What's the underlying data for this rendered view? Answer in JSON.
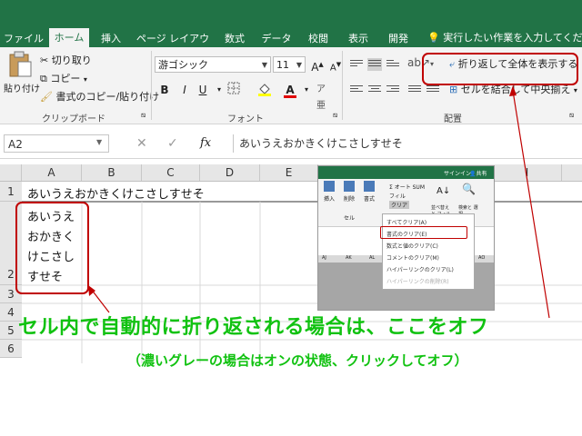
{
  "tabs": [
    {
      "label": "ファイル",
      "active": false
    },
    {
      "label": "ホーム",
      "active": true
    },
    {
      "label": "挿入",
      "active": false
    },
    {
      "label": "ページ レイアウト",
      "active": false
    },
    {
      "label": "数式",
      "active": false
    },
    {
      "label": "データ",
      "active": false
    },
    {
      "label": "校閲",
      "active": false
    },
    {
      "label": "表示",
      "active": false
    },
    {
      "label": "開発",
      "active": false
    }
  ],
  "tell_me": "実行したい作業を入力してください",
  "clipboard": {
    "paste": "貼り付け",
    "cut": "切り取り",
    "copy": "コピー",
    "format_painter": "書式のコピー/貼り付け",
    "group_label": "クリップボード"
  },
  "font": {
    "name": "游ゴシック",
    "size": "11",
    "bold": "B",
    "italic": "I",
    "underline": "U",
    "grow": "A",
    "shrink": "A",
    "font_color": "A",
    "group_label": "フォント"
  },
  "alignment": {
    "wrap_text": "折り返して全体を表示する",
    "merge_center": "セルを結合して中央揃え",
    "group_label": "配置"
  },
  "formula_bar": {
    "name_box": "A2",
    "fx": "fx",
    "content": "あいうえおかきくけこさしすせそ"
  },
  "grid": {
    "columns": [
      "A",
      "B",
      "C",
      "D",
      "E",
      "I"
    ],
    "rows": [
      "1",
      "2",
      "3",
      "4",
      "5",
      "6"
    ],
    "a1": "あいうえおかきくけこさしすせそ",
    "a2_lines": [
      "あいうえ",
      "おかきく",
      "けこさし",
      "すせそ"
    ]
  },
  "inset": {
    "sign_in": "サインイン",
    "share": "共有",
    "autosum": "オート SUM",
    "fill": "フィル",
    "clear": "クリア",
    "sort_filter": "並べ替えと フィルター",
    "find_select": "検索と 選択",
    "insert": "挿入",
    "delete": "削除",
    "format": "書式",
    "cells_label": "セル",
    "menu": [
      "すべてクリア(A)",
      "書式のクリア(E)",
      "数式と値のクリア(C)",
      "コメントのクリア(M)",
      "ハイパーリンクのクリア(L)",
      "ハイパーリンクの削除(R)"
    ],
    "cols": [
      "AJ",
      "AK",
      "AL",
      "AM",
      "AN",
      "AO"
    ]
  },
  "caption_main": "セル内で自動的に折り返される場合は、ここをオフ",
  "caption_sub": "（濃いグレーの場合はオンの状態、クリックしてオフ）",
  "colors": {
    "excel_green": "#217346",
    "callout_red": "#c00000",
    "caption_green": "#11c211"
  }
}
